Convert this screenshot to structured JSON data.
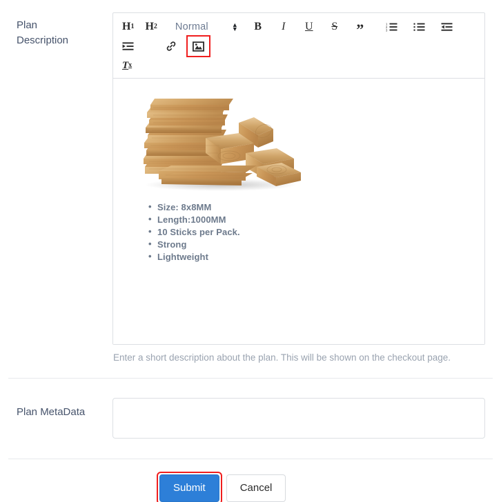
{
  "form": {
    "fields": [
      {
        "id": "plan-description",
        "label_line1": "Plan",
        "label_line2": "Description",
        "help_text": "Enter a short description about the plan. This will be shown on the checkout page."
      },
      {
        "id": "plan-metadata",
        "label": "Plan MetaData",
        "value": "",
        "placeholder": ""
      }
    ]
  },
  "editor": {
    "toolbar": {
      "heading1": "H",
      "heading1_sub": "1",
      "heading2": "H",
      "heading2_sub": "2",
      "format_picker_value": "Normal",
      "format_picker_options": [
        "Normal"
      ],
      "bold": "B",
      "italic": "I",
      "underline": "U",
      "strikethrough": "S",
      "blockquote": "”",
      "clear_format": "T",
      "clear_format_sub": "x",
      "icons": {
        "ordered_list": "ordered-list-icon",
        "bullet_list": "bullet-list-icon",
        "outdent": "outdent-icon",
        "indent": "indent-icon",
        "link": "link-icon",
        "image": "image-icon"
      },
      "highlighted_button": "image-icon"
    },
    "content": {
      "image_alt": "stack-of-wooden-planks",
      "spec_items": [
        "Size: 8x8MM",
        "Length:1000MM",
        "10 Sticks per Pack.",
        "Strong",
        "Lightweight"
      ]
    }
  },
  "actions": {
    "submit_label": "Submit",
    "cancel_label": "Cancel",
    "highlighted_button": "submit-button"
  },
  "colors": {
    "submit_blue": "#2d7fd8",
    "highlight_red": "#f01e1e",
    "label_text": "#46536b",
    "help_text": "#9aa3b0",
    "spec_text": "#6d7a8c",
    "border": "#dcdfe3"
  }
}
